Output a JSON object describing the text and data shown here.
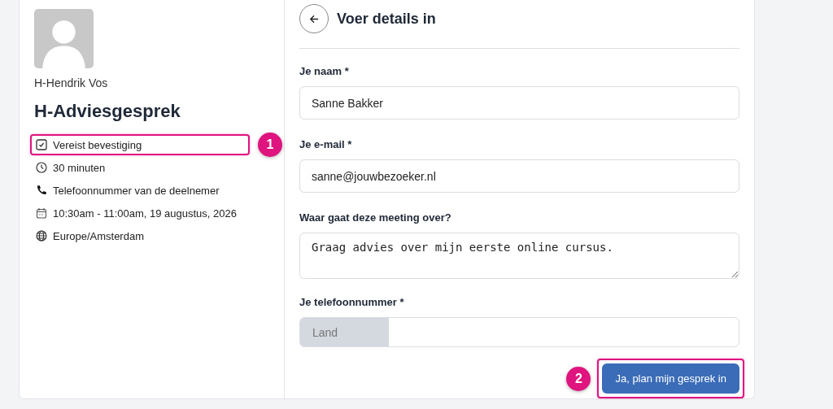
{
  "host": {
    "name": "H-Hendrik Vos"
  },
  "event": {
    "title": "H-Adviesgesprek",
    "details": [
      {
        "kind": "confirm",
        "text": "Vereist bevestiging",
        "highlighted": true,
        "callout": "1"
      },
      {
        "kind": "duration",
        "text": "30 minuten",
        "highlighted": false
      },
      {
        "kind": "phone",
        "text": "Telefoonnummer van de deelnemer",
        "highlighted": false
      },
      {
        "kind": "date",
        "text": "10:30am - 11:00am, 19 augustus, 2026",
        "highlighted": false
      },
      {
        "kind": "timezone",
        "text": "Europe/Amsterdam",
        "highlighted": false
      }
    ]
  },
  "form": {
    "title": "Voer details in",
    "fields": [
      {
        "kind": "text",
        "label": "Je naam *",
        "value": "Sanne Bakker"
      },
      {
        "kind": "text",
        "label": "Je e-mail *",
        "value": "sanne@jouwbezoeker.nl"
      },
      {
        "kind": "textarea",
        "label": "Waar gaat deze meeting over?",
        "value": "Graag advies over mijn eerste online cursus."
      },
      {
        "kind": "phone",
        "label": "Je telefoonnummer *",
        "country_placeholder": "Land"
      }
    ],
    "submit": {
      "label": "Ja, plan mijn gesprek in",
      "highlighted": true,
      "callout": "2"
    }
  }
}
